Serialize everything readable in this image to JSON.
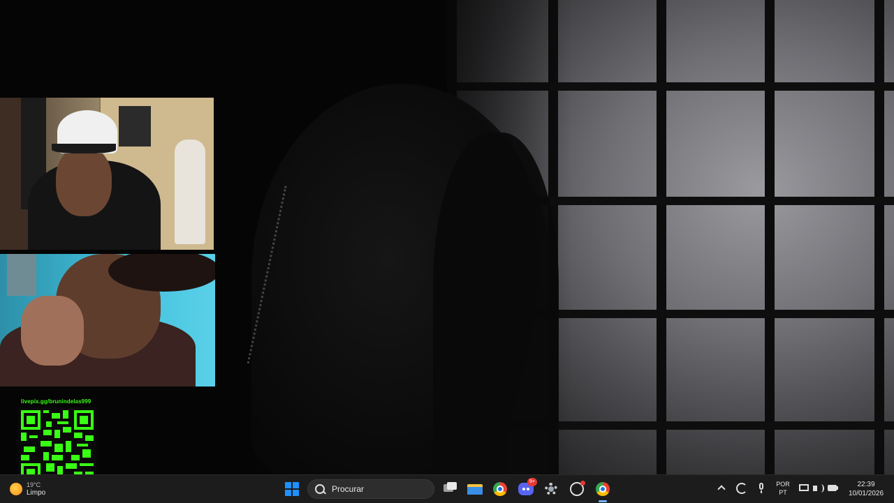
{
  "livepix": {
    "url": "livepix.gg/brunindelas999"
  },
  "weather": {
    "temp": "19°C",
    "condition": "Limpo",
    "icon": "sun-icon"
  },
  "taskbar": {
    "search_placeholder": "Procurar",
    "discord_badge": "9+",
    "language": {
      "line1": "POR",
      "line2": "PT"
    },
    "time": "22:39",
    "date": "10/01/2026"
  },
  "colors": {
    "livepix_green": "#39ff14",
    "start_blue": "#1e90ff",
    "taskbar_bg": "#1c1c1c"
  }
}
